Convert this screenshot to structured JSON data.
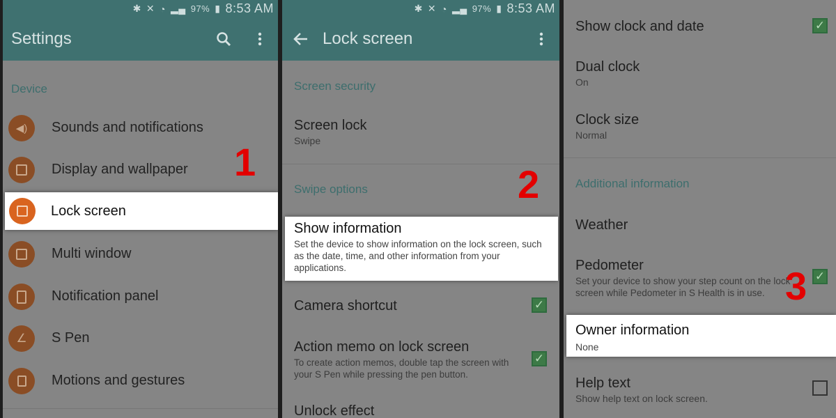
{
  "status": {
    "battery": "97%",
    "time": "8:53 AM"
  },
  "panel1": {
    "title": "Settings",
    "section": "Device",
    "items": [
      {
        "label": "Sounds and notifications",
        "icon": "speaker-icon"
      },
      {
        "label": "Display and wallpaper",
        "icon": "display-icon"
      },
      {
        "label": "Lock screen",
        "icon": "lock-screen-icon"
      },
      {
        "label": "Multi window",
        "icon": "multi-window-icon"
      },
      {
        "label": "Notification panel",
        "icon": "notification-panel-icon"
      },
      {
        "label": "S Pen",
        "icon": "pen-icon"
      },
      {
        "label": "Motions and gestures",
        "icon": "motions-icon"
      }
    ],
    "step": "1"
  },
  "panel2": {
    "title": "Lock screen",
    "section_security": "Screen security",
    "screen_lock": {
      "title": "Screen lock",
      "sub": "Swipe"
    },
    "section_swipe": "Swipe options",
    "show_info": {
      "title": "Show information",
      "sub": "Set the device to show information on the lock screen, such as the date, time, and other information from your applications."
    },
    "camera": {
      "title": "Camera shortcut"
    },
    "action_memo": {
      "title": "Action memo on lock screen",
      "sub": "To create action memos, double tap the screen with your S Pen while pressing the pen button."
    },
    "unlock": {
      "title": "Unlock effect"
    },
    "step": "2"
  },
  "panel3": {
    "clock_date": {
      "title": "Show clock and date"
    },
    "dual_clock": {
      "title": "Dual clock",
      "sub": "On"
    },
    "clock_size": {
      "title": "Clock size",
      "sub": "Normal"
    },
    "section_additional": "Additional information",
    "weather": {
      "title": "Weather"
    },
    "pedometer": {
      "title": "Pedometer",
      "sub": "Set your device to show your step count on the lock screen while Pedometer in S Health is in use."
    },
    "owner": {
      "title": "Owner information",
      "sub": "None"
    },
    "help": {
      "title": "Help text",
      "sub": "Show help text on lock screen."
    },
    "step": "3"
  }
}
